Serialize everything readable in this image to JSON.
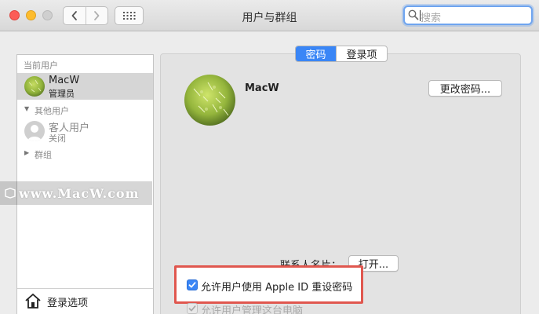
{
  "window": {
    "title": "用户与群组"
  },
  "search": {
    "placeholder": "搜索"
  },
  "sidebar": {
    "current_users_label": "当前用户",
    "current_user": {
      "name": "MacW",
      "role": "管理员"
    },
    "other_users_label": "其他用户",
    "guest_user": {
      "name": "客人用户",
      "status": "关闭"
    },
    "groups_label": "群组",
    "login_options_label": "登录选项"
  },
  "tabs": [
    {
      "label": "密码",
      "active": true
    },
    {
      "label": "登录项",
      "active": false
    }
  ],
  "main": {
    "user_name": "MacW",
    "change_password_label": "更改密码...",
    "contact_card_label": "联系人名片：",
    "open_button_label": "打开...",
    "allow_appleid_reset_label": "允许用户使用 Apple ID 重设密码",
    "allow_appleid_reset_checked": true,
    "allow_admin_label": "允许用户管理这台电脑",
    "allow_admin_checked": true
  },
  "watermark": {
    "text": "www.MacW.com"
  },
  "colors": {
    "accent": "#3a86f6",
    "highlight_border": "#e0574f"
  }
}
